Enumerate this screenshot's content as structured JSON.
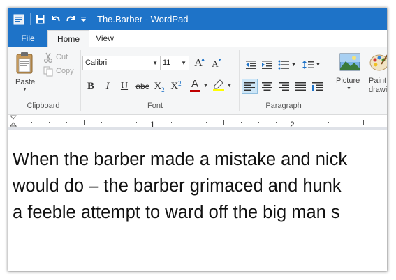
{
  "window": {
    "title": "The.Barber - WordPad"
  },
  "quick_access": {
    "icons": [
      "app-icon",
      "save-icon",
      "undo-icon",
      "redo-icon",
      "customize-dropdown-icon"
    ]
  },
  "tabs": {
    "file": "File",
    "home": "Home",
    "view": "View"
  },
  "clipboard": {
    "paste": "Paste",
    "cut": "Cut",
    "copy": "Copy",
    "group_label": "Clipboard"
  },
  "font": {
    "family": "Calibri",
    "size": "11",
    "group_label": "Font",
    "bold": "B",
    "italic": "I",
    "underline": "U",
    "strikethrough": "abc",
    "subscript_base": "X",
    "subscript_mark": "2",
    "superscript_base": "X",
    "superscript_mark": "2",
    "grow_font": "A",
    "shrink_font": "A",
    "font_color_glyph": "A",
    "font_color": "#c00000",
    "highlight_color": "#ffff00"
  },
  "paragraph": {
    "group_label": "Paragraph"
  },
  "insert": {
    "picture": "Picture",
    "paint_drawing": "Paint drawi"
  },
  "ruler": {
    "marks": [
      "1",
      "2"
    ]
  },
  "document": {
    "lines": [
      "When the barber made a mistake and nick",
      "would do – the barber grimaced and hunk",
      "a feeble attempt to ward off the big man s"
    ]
  },
  "colors": {
    "title_bar": "#1e73c8",
    "file_tab": "#1e73c8",
    "ribbon_bg": "#f5f6f7",
    "accent_icon": "#1e73c8"
  }
}
